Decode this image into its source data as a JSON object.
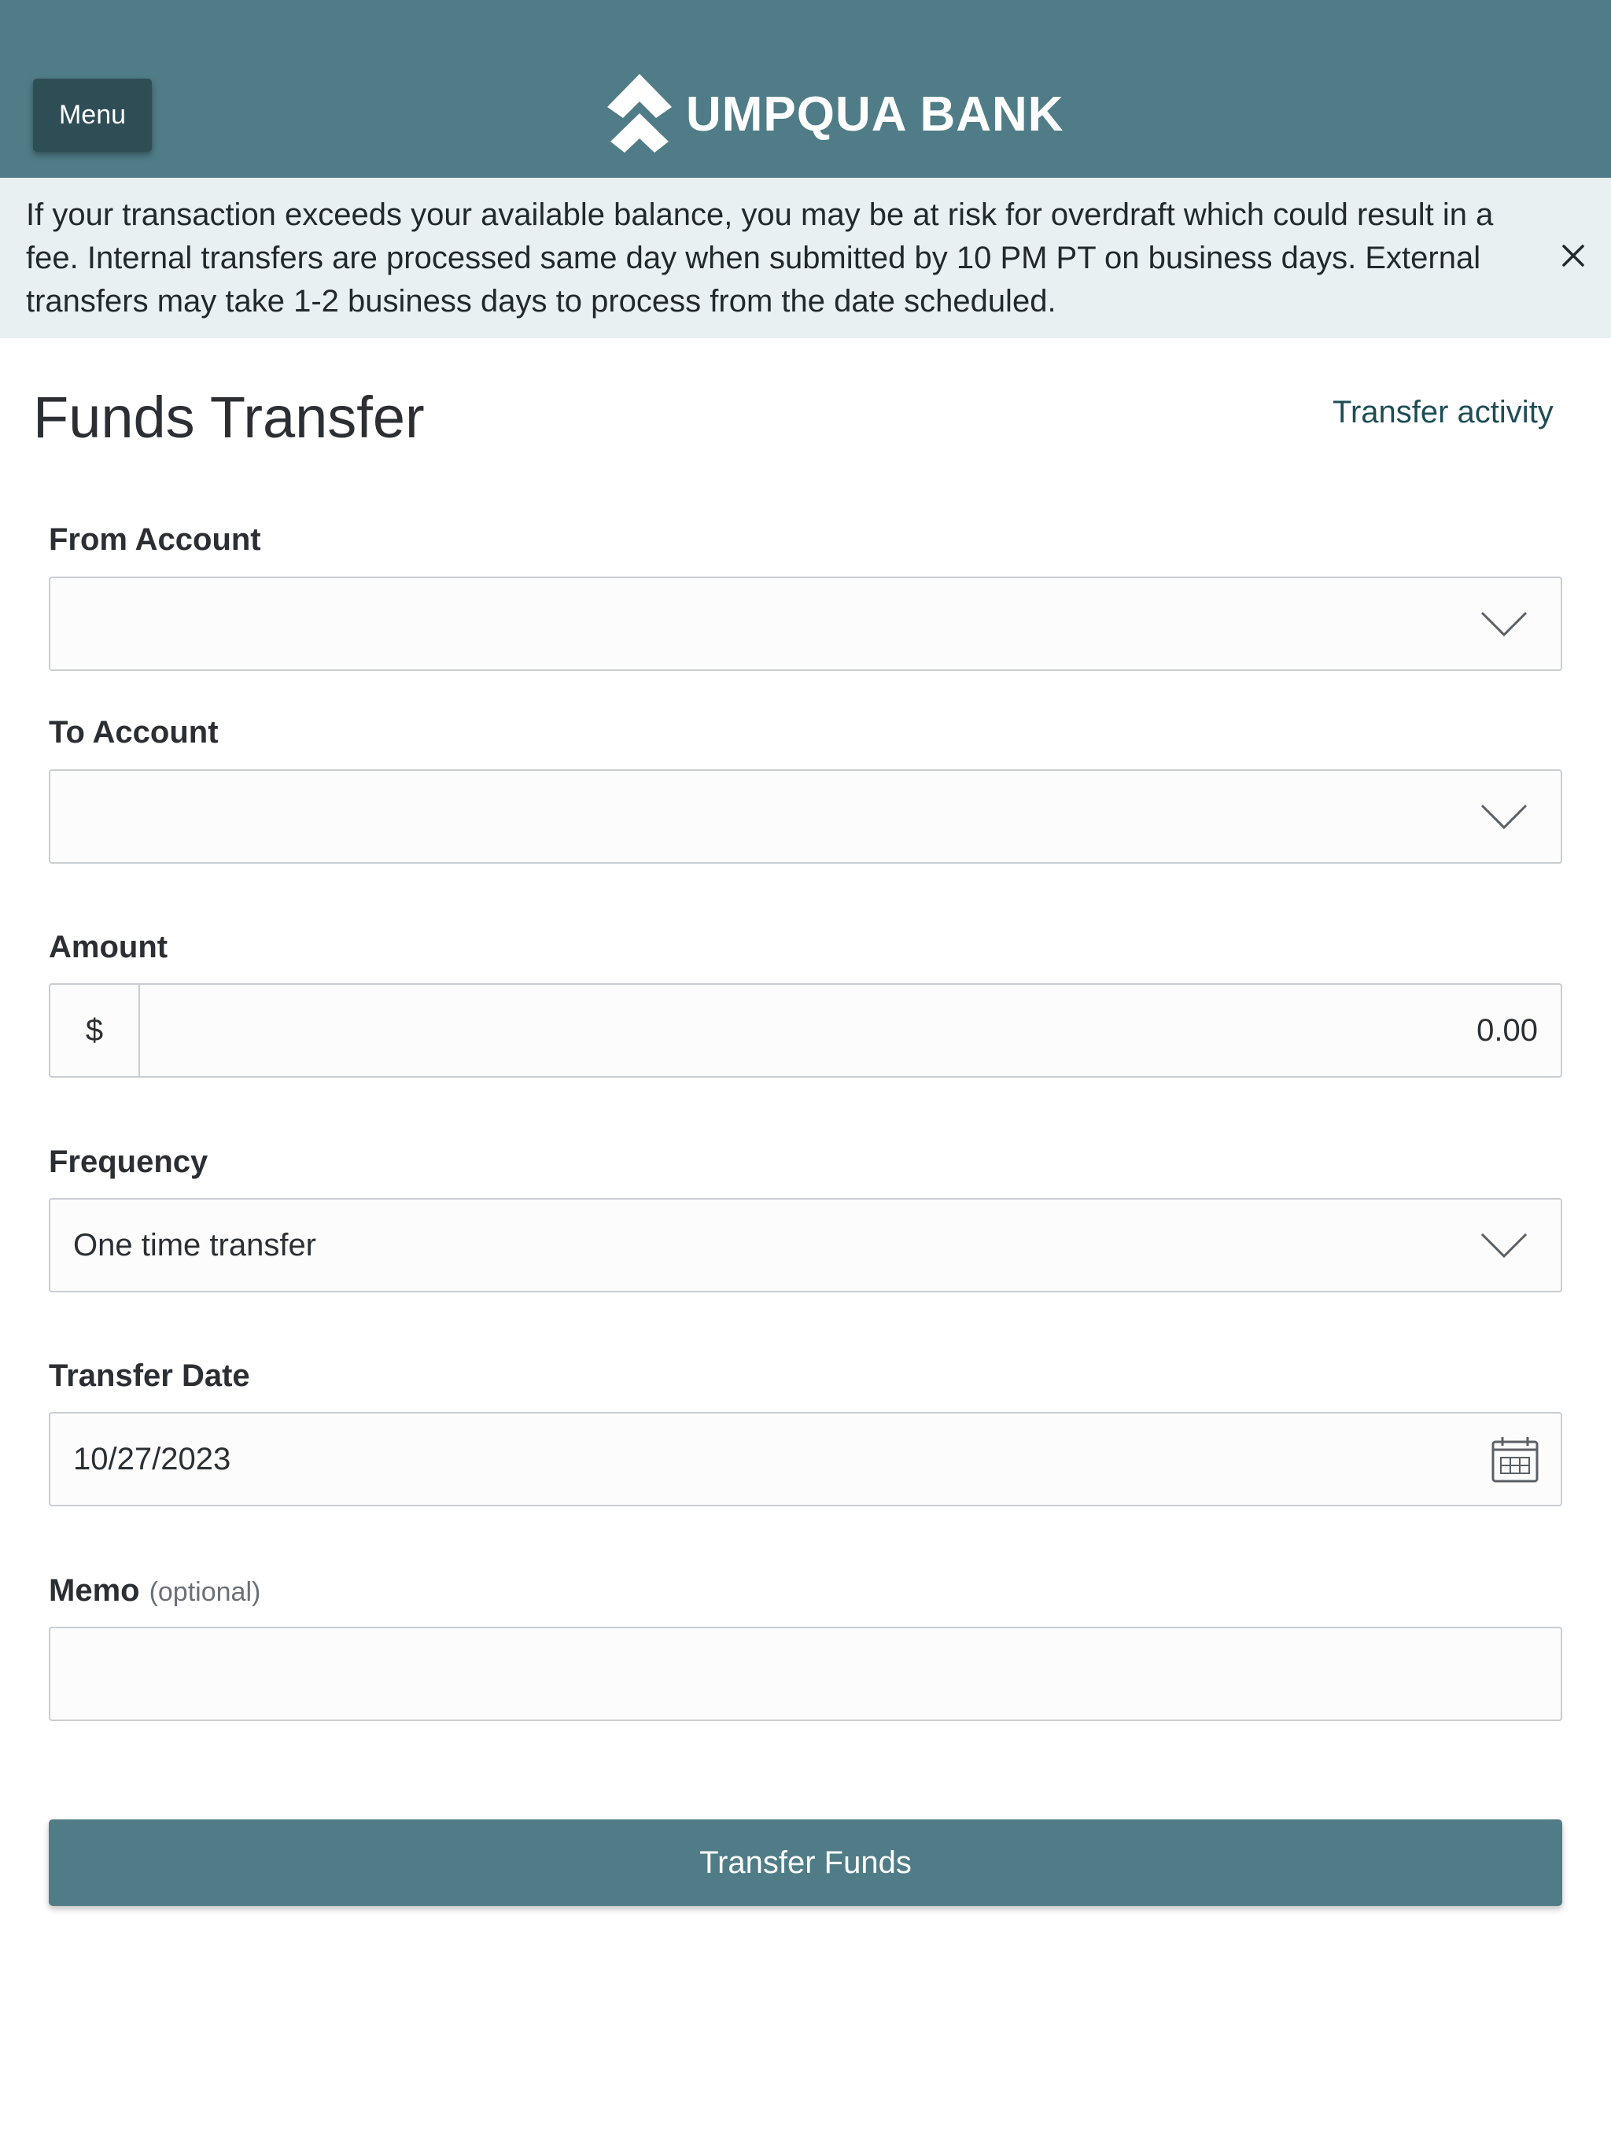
{
  "header": {
    "menu_label": "Menu",
    "brand_name": "UMPQUA BANK",
    "bg_color": "#4f7c87"
  },
  "notice": {
    "text": "If your transaction exceeds your available balance, you may be at risk for overdraft which could result in a fee. Internal transfers are processed same day when submitted by 10 PM PT on business days. External transfers may take 1-2 business days to process from the date scheduled.",
    "close_icon": "close-icon"
  },
  "page": {
    "title": "Funds Transfer",
    "activity_link": "Transfer activity"
  },
  "form": {
    "from_account": {
      "label": "From Account",
      "value": ""
    },
    "to_account": {
      "label": "To Account",
      "value": ""
    },
    "amount": {
      "label": "Amount",
      "currency_symbol": "$",
      "value": "0.00"
    },
    "frequency": {
      "label": "Frequency",
      "value": "One time transfer"
    },
    "transfer_date": {
      "label": "Transfer Date",
      "value": "10/27/2023",
      "icon": "calendar-icon"
    },
    "memo": {
      "label": "Memo",
      "optional_hint": "(optional)",
      "value": ""
    },
    "submit_label": "Transfer Funds"
  },
  "colors": {
    "accent": "#4f7c87",
    "menu_button": "#2f4d55",
    "notice_bg": "#e9f0f2",
    "link": "#1d4d55"
  }
}
